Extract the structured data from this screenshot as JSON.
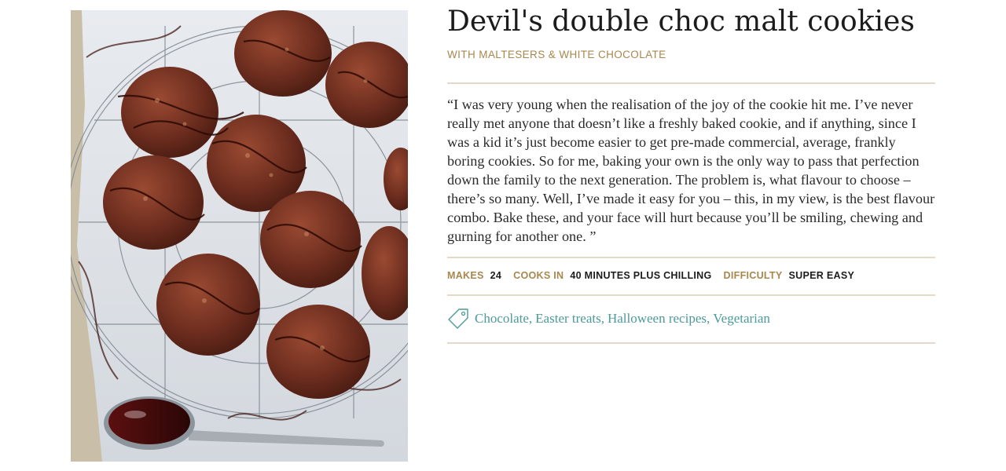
{
  "recipe": {
    "title": "Devil's double choc malt cookies",
    "subtitle": "WITH MALTESERS & WHITE CHOCOLATE",
    "intro": "“I was very young when the realisation of the joy of the cookie hit me. I’ve never really met anyone that doesn’t like a freshly baked cookie, and if anything, since I was a kid it’s just become easier to get pre-made commercial, average, frankly boring cookies. So for me, baking your own is the only way to pass that perfection down the family to the next generation. The problem is, what flavour to choose – there’s so many. Well, I’ve made it easy for you – this, in my view, is the best flavour combo. Bake these, and your face will hurt because you’ll be smiling, chewing and gurning for another one. ”",
    "meta": {
      "makes_label": "MAKES",
      "makes_value": "24",
      "cooks_label": "COOKS IN",
      "cooks_value": "40 MINUTES PLUS CHILLING",
      "difficulty_label": "DIFFICULTY",
      "difficulty_value": "SUPER EASY"
    },
    "tags": [
      "Chocolate",
      "Easter treats",
      "Halloween recipes",
      "Vegetarian"
    ],
    "tag_separator": ","
  },
  "icons": {
    "tag": "tag-icon"
  },
  "colors": {
    "accent_gold": "#a8874d",
    "link_teal": "#4c9a9a",
    "rule": "#e4d9c8",
    "text": "#2a2a2a"
  }
}
